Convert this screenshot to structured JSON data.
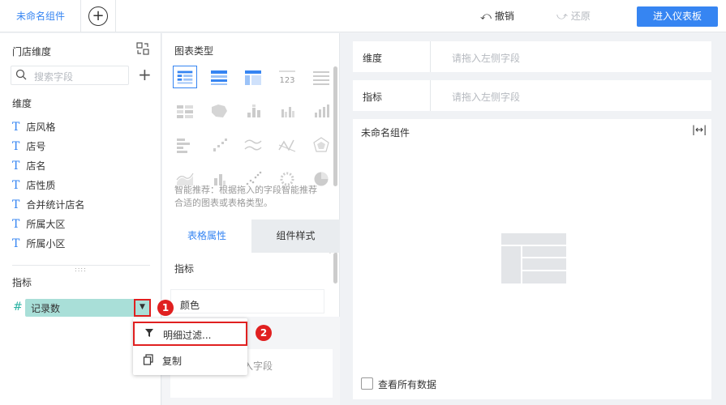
{
  "topbar": {
    "tab_label": "未命名组件",
    "undo_label": "撤销",
    "redo_label": "还原",
    "enter_dashboard_label": "进入仪表板"
  },
  "left_panel": {
    "title": "门店维度",
    "search_placeholder": "搜索字段",
    "dimension_label": "维度",
    "dimension_fields": [
      "店风格",
      "店号",
      "店名",
      "店性质",
      "合并统计店名",
      "所属大区",
      "所属小区"
    ],
    "indicator_label": "指标",
    "metric_field": "记录数"
  },
  "dropdown": {
    "filter_label": "明细过滤...",
    "copy_label": "复制"
  },
  "badges": {
    "one": "1",
    "two": "2"
  },
  "middle_panel": {
    "chart_type_title": "图表类型",
    "hint_text": "智能推荐：根据拖入的字段智能推荐合适的图表或表格类型。",
    "tab_table_props": "表格属性",
    "tab_component_style": "组件样式",
    "indicator_label": "指标",
    "color_label": "颜色",
    "drop_field_text": "入字段"
  },
  "right_panel": {
    "dimension_label": "维度",
    "indicator_label": "指标",
    "dimension_placeholder": "请拖入左侧字段",
    "indicator_placeholder": "请拖入左侧字段",
    "component_title": "未命名组件",
    "view_all_label": "查看所有数据"
  },
  "colors": {
    "accent": "#3685f2",
    "metric_pill": "#a9dfd8",
    "highlight_red": "#e02020"
  }
}
